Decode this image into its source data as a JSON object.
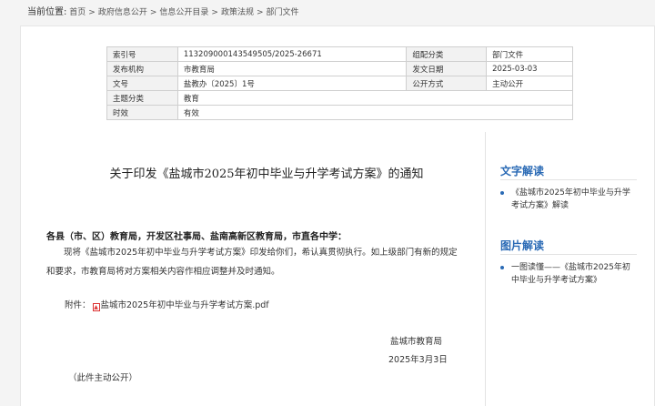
{
  "breadcrumb": {
    "label": "当前位置:",
    "items": [
      "首页",
      "政府信息公开",
      "信息公开目录",
      "政策法规",
      "部门文件"
    ],
    "sep": ">"
  },
  "meta": {
    "index_no_label": "索引号",
    "index_no": "113209000143549505/2025-26671",
    "category_label": "组配分类",
    "category": "部门文件",
    "issuer_label": "发布机构",
    "issuer": "市教育局",
    "issue_date_label": "发文日期",
    "issue_date": "2025-03-03",
    "doc_no_label": "文号",
    "doc_no": "盐教办〔2025〕1号",
    "publish_mode_label": "公开方式",
    "publish_mode": "主动公开",
    "topic_label": "主题分类",
    "topic": "教育",
    "validity_label": "时效",
    "validity": "有效"
  },
  "doc": {
    "title": "关于印发《盐城市2025年初中毕业与升学考试方案》的通知",
    "addressee": "各县（市、区）教育局，开发区社事局、盐南高新区教育局，市直各中学：",
    "body": "现将《盐城市2025年初中毕业与升学考试方案》印发给你们，希认真贯彻执行。如上级部门有新的规定和要求，市教育局将对方案相关内容作相应调整并及时通知。",
    "attachment_label": "附件：",
    "pdf_icon": "pdf-icon",
    "attachment_name": "盐城市2025年初中毕业与升学考试方案.pdf",
    "signature_org": "盐城市教育局",
    "signature_date": "2025年3月3日",
    "footnote": "（此件主动公开）"
  },
  "sidebar": {
    "text_interp_title": "文字解读",
    "text_interp_item": "《盐城市2025年初中毕业与升学考试方案》解读",
    "image_interp_title": "图片解读",
    "image_interp_item": "一图读懂——《盐城市2025年初中毕业与升学考试方案》",
    "accent": "#2a6ab5"
  }
}
